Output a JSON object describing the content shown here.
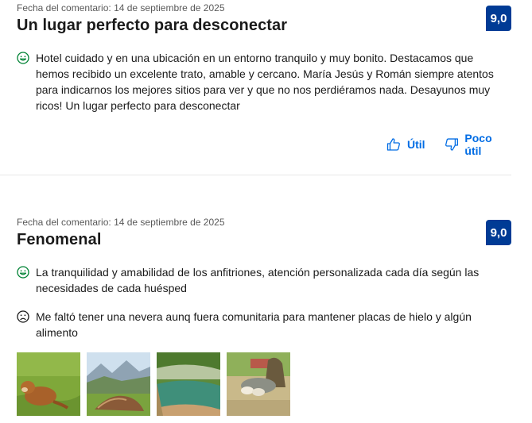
{
  "reviews": [
    {
      "date": "Fecha del comentario: 14 de septiembre de 2025",
      "title": "Un lugar perfecto para desconectar",
      "score": "9,0",
      "positive_icon": "smile-face-icon",
      "positive": "Hotel cuidado y en una ubicación en un entorno tranquilo y muy bonito. Destacamos que hemos recibido un excelente trato, amable y cercano. María Jesús y Román siempre atentos para indicarnos los mejores sitios para ver y que no nos perdiéramos nada. Desayunos muy ricos! Un lugar perfecto para desconectar",
      "helpful_label": "Útil",
      "not_helpful_label": "Poco útil"
    },
    {
      "date": "Fecha del comentario: 14 de septiembre de 2025",
      "title": "Fenomenal",
      "score": "9,0",
      "positive_icon": "smile-face-icon",
      "positive": "La tranquilidad y amabilidad de los anfitriones, atención personalizada cada día según las necesidades de cada huésped",
      "negative_icon": "sad-face-icon",
      "negative": "Me faltó tener una nevera aunq fuera comunitaria para mantener placas de hielo y algún alimento",
      "photos": [
        "calf-photo",
        "mountain-meadow-photo",
        "river-pool-photo",
        "village-hut-photo"
      ]
    }
  ],
  "colors": {
    "score_bg": "#003b95",
    "link": "#006ce4",
    "positive": "#008234",
    "negative": "#1a1a1a"
  }
}
